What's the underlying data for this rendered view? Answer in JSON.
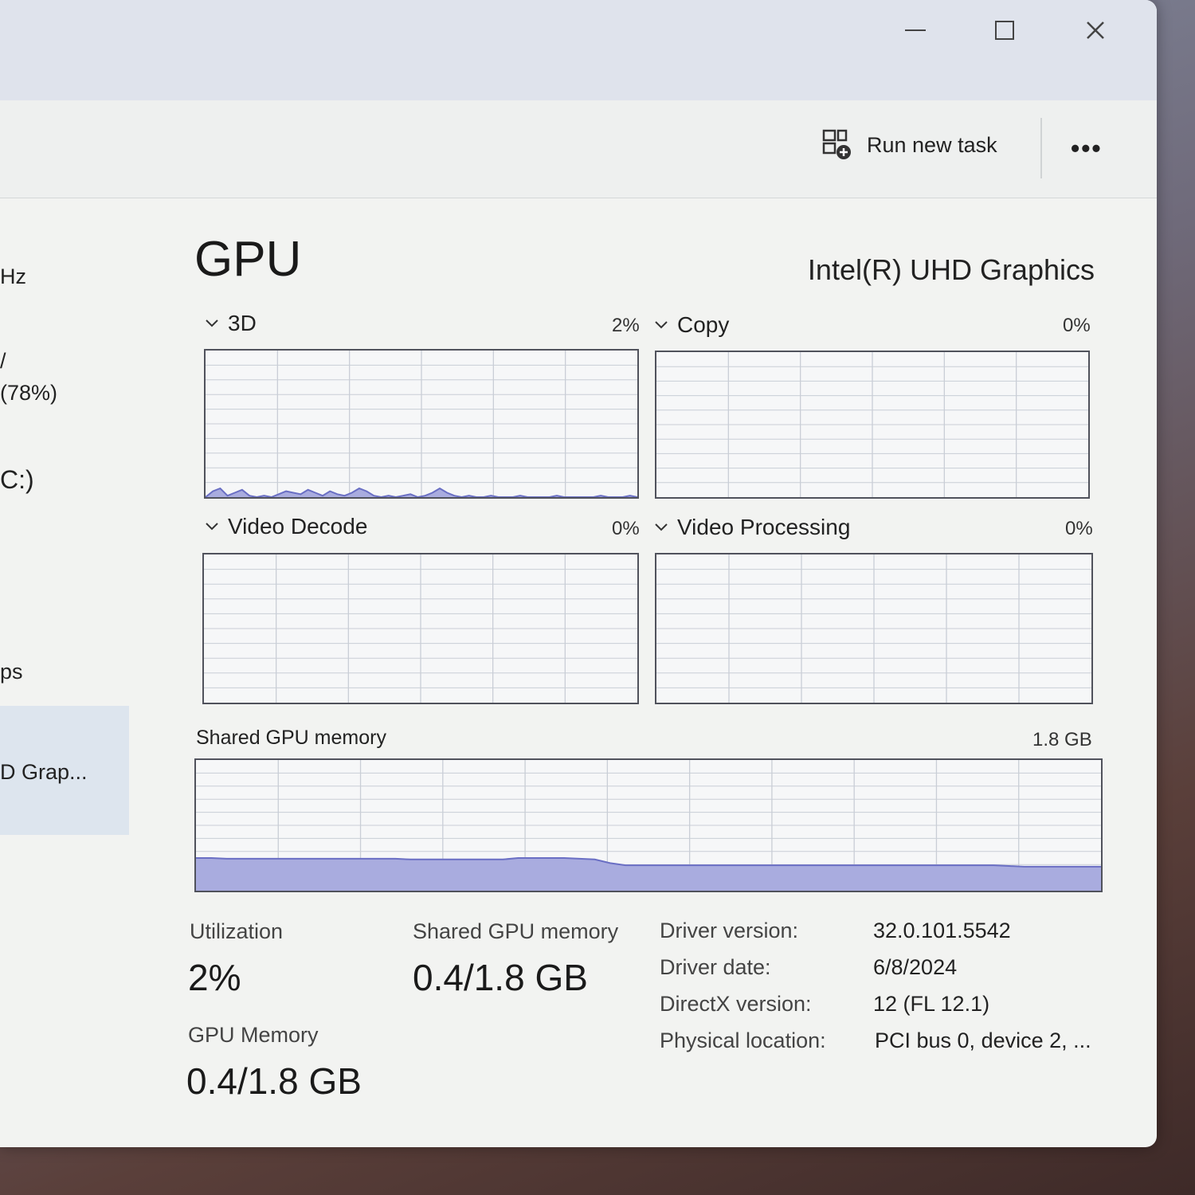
{
  "window": {
    "controls": {
      "minimize": "minimize",
      "maximize": "maximize",
      "close": "close"
    }
  },
  "toolbar": {
    "run_new_task_label": "Run new task",
    "more_label": "•••"
  },
  "sidebar": {
    "fragments": [
      "Hz",
      "/",
      "(78%)",
      "C:)",
      "ps",
      "D Grap..."
    ]
  },
  "header": {
    "title": "GPU",
    "adapter_name": "Intel(R) UHD Graphics"
  },
  "engines": [
    {
      "label": "3D",
      "percent": "2%"
    },
    {
      "label": "Copy",
      "percent": "0%"
    },
    {
      "label": "Video Decode",
      "percent": "0%"
    },
    {
      "label": "Video Processing",
      "percent": "0%"
    }
  ],
  "shared_memory_graph": {
    "label": "Shared GPU memory",
    "max": "1.8 GB"
  },
  "stats": {
    "utilization_label": "Utilization",
    "utilization_value": "2%",
    "shared_mem_label": "Shared GPU memory",
    "shared_mem_value": "0.4/1.8 GB",
    "gpu_mem_label": "GPU Memory",
    "gpu_mem_value": "0.4/1.8 GB"
  },
  "details": [
    {
      "label": "Driver version:",
      "value": "32.0.101.5542"
    },
    {
      "label": "Driver date:",
      "value": "6/8/2024"
    },
    {
      "label": "DirectX version:",
      "value": "12 (FL 12.1)"
    },
    {
      "label": "Physical location:",
      "value": "PCI bus 0, device 2, ..."
    }
  ],
  "colors": {
    "graph_line": "#6a6fc4",
    "graph_fill": "#a9acdf",
    "grid": "#c9ced6",
    "selected": "#dde5ee"
  },
  "chart_data": [
    {
      "type": "line",
      "title": "3D",
      "ylim": [
        0,
        100
      ],
      "values": [
        0,
        4,
        6,
        1,
        3,
        5,
        1,
        0,
        1,
        0,
        2,
        4,
        3,
        2,
        5,
        3,
        1,
        4,
        2,
        1,
        3,
        6,
        4,
        1,
        0,
        1,
        0,
        1,
        2,
        0,
        1,
        3,
        6,
        3,
        1,
        0,
        1,
        0,
        0,
        1,
        0,
        0,
        0,
        1,
        0,
        0,
        0,
        0,
        1,
        0,
        0,
        0,
        0,
        0,
        1,
        0,
        0,
        0,
        1,
        0
      ]
    },
    {
      "type": "area",
      "title": "Shared GPU memory",
      "ylim": [
        0,
        1.8
      ],
      "values": [
        0.45,
        0.45,
        0.44,
        0.44,
        0.44,
        0.44,
        0.44,
        0.44,
        0.44,
        0.44,
        0.44,
        0.44,
        0.44,
        0.44,
        0.43,
        0.43,
        0.43,
        0.43,
        0.43,
        0.43,
        0.43,
        0.45,
        0.45,
        0.45,
        0.45,
        0.44,
        0.43,
        0.38,
        0.35,
        0.35,
        0.35,
        0.35,
        0.35,
        0.35,
        0.35,
        0.35,
        0.35,
        0.35,
        0.35,
        0.35,
        0.35,
        0.35,
        0.35,
        0.35,
        0.35,
        0.35,
        0.35,
        0.35,
        0.35,
        0.35,
        0.35,
        0.35,
        0.35,
        0.34,
        0.33,
        0.33,
        0.33,
        0.33,
        0.33,
        0.33
      ]
    }
  ]
}
